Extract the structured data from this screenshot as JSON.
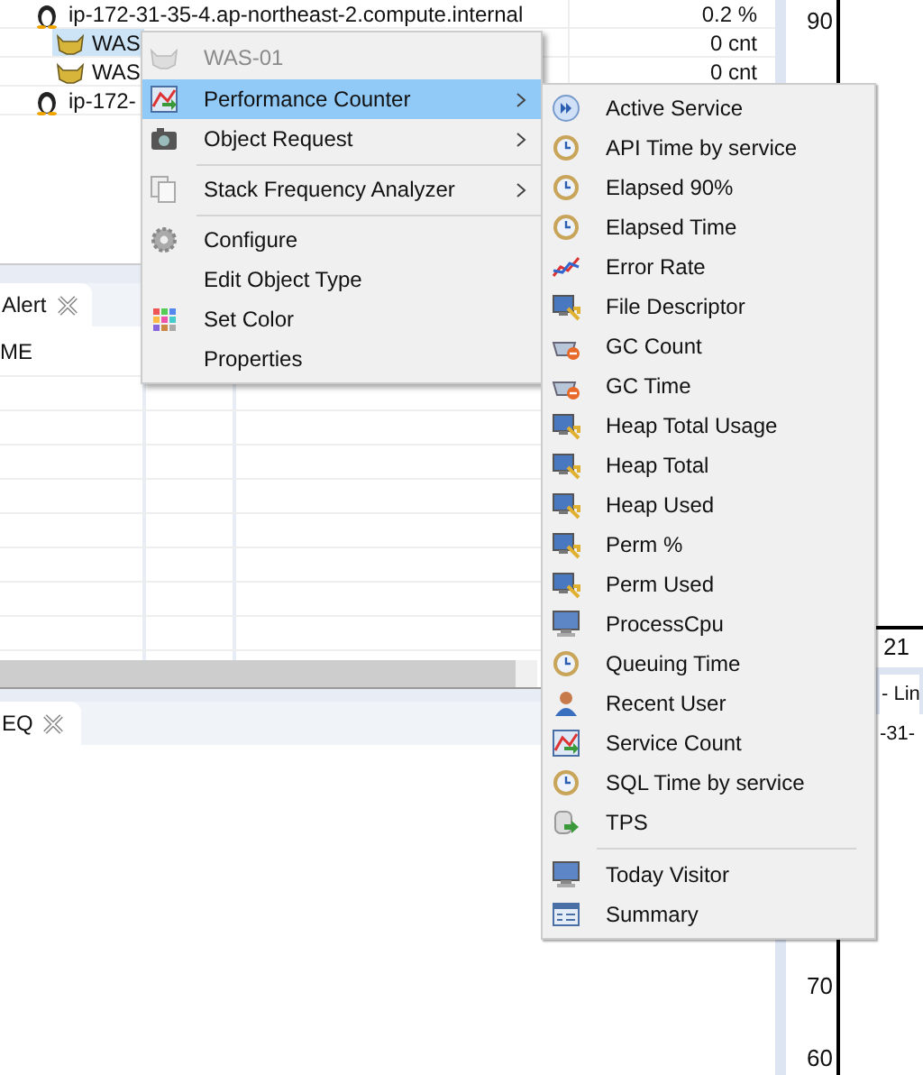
{
  "tree": {
    "rows": [
      {
        "kind": "host",
        "label": "ip-172-31-35-4.ap-northeast-2.compute.internal",
        "value": "0.2 %",
        "selected": false
      },
      {
        "kind": "was",
        "label": "WAS",
        "value": "0 cnt",
        "selected": true
      },
      {
        "kind": "was",
        "label": "WAS",
        "value": "0 cnt",
        "selected": false
      },
      {
        "kind": "host",
        "label": "ip-172-",
        "selected": false
      }
    ]
  },
  "alert_view": {
    "tab": "Alert",
    "column_1": "ME"
  },
  "eq_view": {
    "tab": "EQ"
  },
  "chart_panel": {
    "top_ticks": [
      "90"
    ],
    "x_label": "21",
    "tab": "- Lin",
    "subtitle": "-31-",
    "bottom_ticks": [
      "70",
      "60"
    ]
  },
  "context_menu": {
    "header": {
      "label": "WAS-01",
      "disabled": true
    },
    "items": [
      {
        "kind": "item",
        "label": "Performance Counter",
        "submenu": true,
        "selected": true
      },
      {
        "kind": "item",
        "label": "Object Request",
        "submenu": true,
        "selected": false
      },
      {
        "kind": "separator"
      },
      {
        "kind": "item",
        "label": "Stack Frequency Analyzer",
        "submenu": true,
        "selected": false
      },
      {
        "kind": "separator"
      },
      {
        "kind": "item",
        "label": "Configure",
        "submenu": false,
        "selected": false
      },
      {
        "kind": "item",
        "label": "Edit Object Type",
        "submenu": false,
        "selected": false
      },
      {
        "kind": "item",
        "label": "Set Color",
        "submenu": false,
        "selected": false
      },
      {
        "kind": "item",
        "label": "Properties",
        "submenu": false,
        "selected": false
      }
    ]
  },
  "submenu": {
    "items": [
      {
        "kind": "item",
        "label": "Active Service"
      },
      {
        "kind": "item",
        "label": "API Time by service"
      },
      {
        "kind": "item",
        "label": "Elapsed 90%"
      },
      {
        "kind": "item",
        "label": "Elapsed Time"
      },
      {
        "kind": "item",
        "label": "Error Rate"
      },
      {
        "kind": "item",
        "label": "File Descriptor"
      },
      {
        "kind": "item",
        "label": "GC Count"
      },
      {
        "kind": "item",
        "label": "GC Time"
      },
      {
        "kind": "item",
        "label": "Heap Total Usage"
      },
      {
        "kind": "item",
        "label": "Heap Total"
      },
      {
        "kind": "item",
        "label": "Heap Used"
      },
      {
        "kind": "item",
        "label": "Perm %"
      },
      {
        "kind": "item",
        "label": "Perm Used"
      },
      {
        "kind": "item",
        "label": "ProcessCpu"
      },
      {
        "kind": "item",
        "label": "Queuing Time"
      },
      {
        "kind": "item",
        "label": "Recent User"
      },
      {
        "kind": "item",
        "label": "Service Count"
      },
      {
        "kind": "item",
        "label": "SQL Time by service"
      },
      {
        "kind": "item",
        "label": "TPS"
      },
      {
        "kind": "separator"
      },
      {
        "kind": "item",
        "label": "Today Visitor"
      },
      {
        "kind": "item",
        "label": "Summary"
      }
    ]
  }
}
